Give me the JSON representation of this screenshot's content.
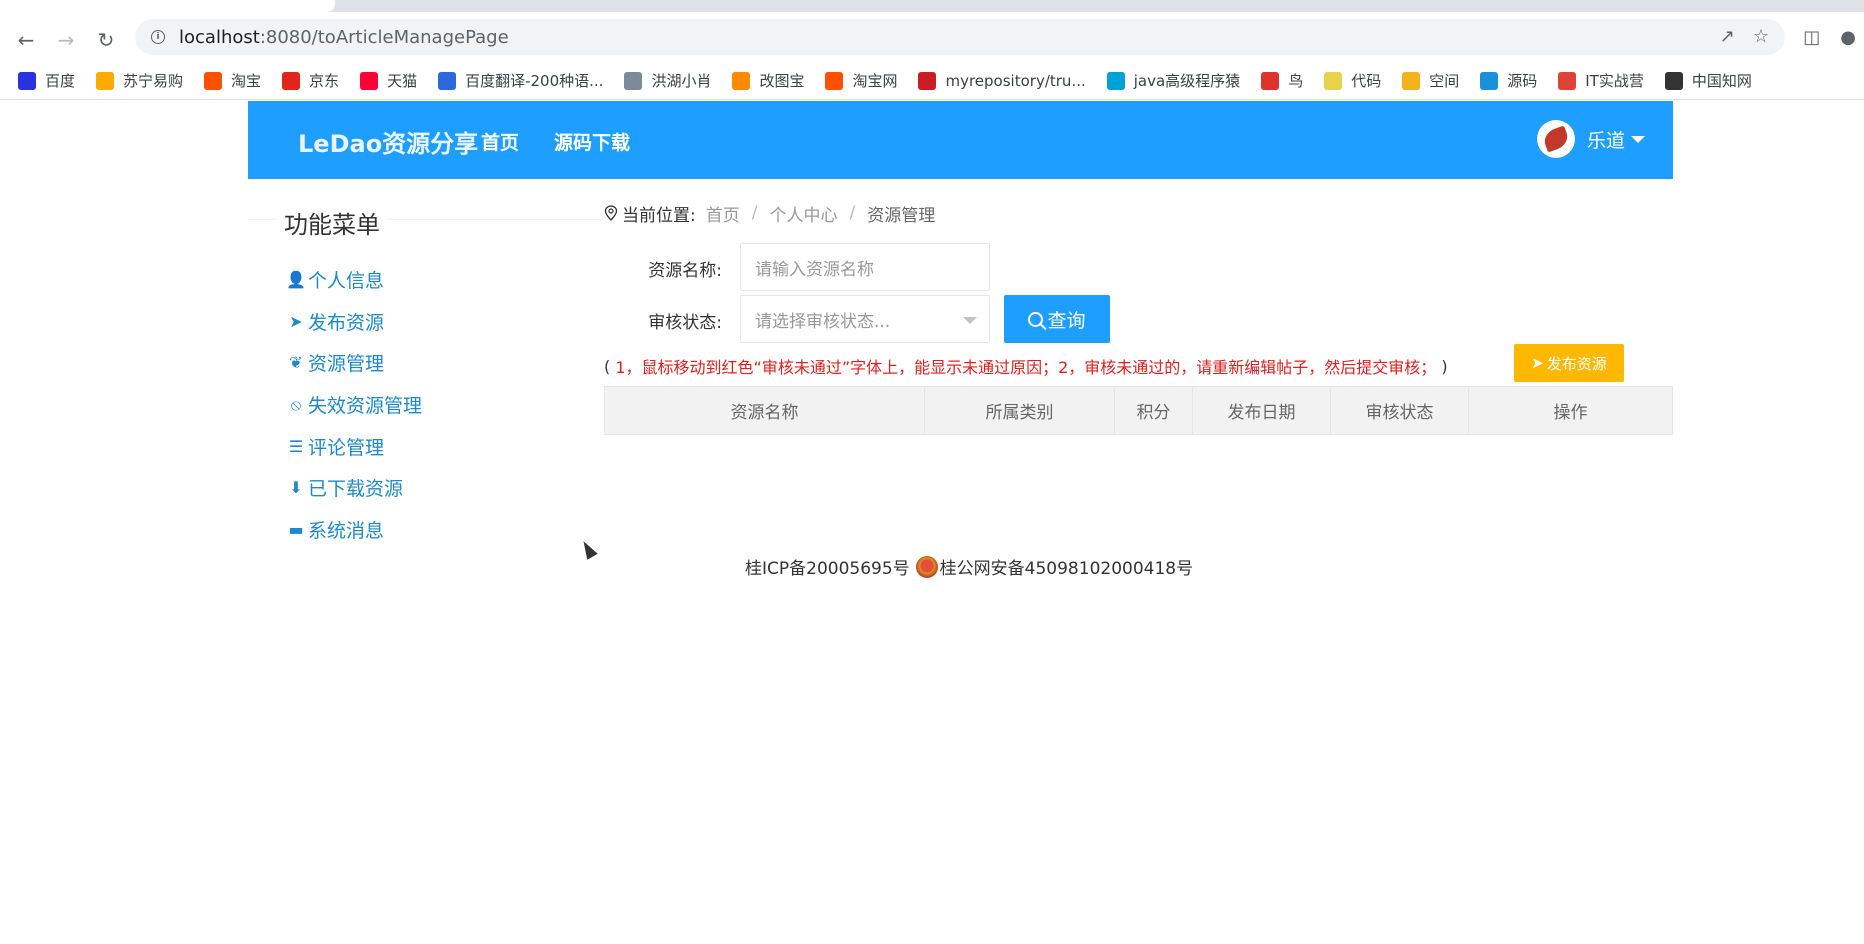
{
  "browser": {
    "url_host": "localhost",
    "url_rest": ":8080/toArticleManagePage",
    "bookmarks": [
      {
        "label": "百度",
        "icon": "baidu-paw-icon",
        "color": "#2932e1"
      },
      {
        "label": "苏宁易购",
        "icon": "suning-icon",
        "color": "#ffaa00"
      },
      {
        "label": "淘宝",
        "icon": "taobao-icon",
        "color": "#ff5000"
      },
      {
        "label": "京东",
        "icon": "jd-icon",
        "color": "#e1251b"
      },
      {
        "label": "天猫",
        "icon": "tmall-icon",
        "color": "#ff0036"
      },
      {
        "label": "百度翻译-200种语...",
        "icon": "baidu-translate-icon",
        "color": "#2b68d9"
      },
      {
        "label": "洪湖小肖",
        "icon": "bird-icon",
        "color": "#7a8a99"
      },
      {
        "label": "改图宝",
        "icon": "gaitubao-icon",
        "color": "#ff8a00"
      },
      {
        "label": "淘宝网",
        "icon": "taobao-icon",
        "color": "#ff5000"
      },
      {
        "label": "myrepository/tru...",
        "icon": "gitee-icon",
        "color": "#c71d23"
      },
      {
        "label": "java高级程序猿",
        "icon": "bilibili-icon",
        "color": "#00a1d6"
      },
      {
        "label": "鸟",
        "icon": "bird-red-icon",
        "color": "#e0322c"
      },
      {
        "label": "代码",
        "icon": "leaf-icon",
        "color": "#e8d24a"
      },
      {
        "label": "空间",
        "icon": "qzone-icon",
        "color": "#f3b11b"
      },
      {
        "label": "源码",
        "icon": "cloud-icon",
        "color": "#1a90d9"
      },
      {
        "label": "IT实战营",
        "icon": "chrome-icon",
        "color": "#db4437"
      },
      {
        "label": "中国知网",
        "icon": "cnki-icon",
        "color": "#333333"
      }
    ]
  },
  "nav": {
    "brand": "LeDao资源分享",
    "links": [
      "首页",
      "源码下载"
    ],
    "username": "乐道"
  },
  "sidebar": {
    "title": "功能菜单",
    "items": [
      {
        "label": "个人信息",
        "icon": "user-icon"
      },
      {
        "label": "发布资源",
        "icon": "paper-plane-icon"
      },
      {
        "label": "资源管理",
        "icon": "leaf-icon"
      },
      {
        "label": "失效资源管理",
        "icon": "ban-icon"
      },
      {
        "label": "评论管理",
        "icon": "comment-icon"
      },
      {
        "label": "已下载资源",
        "icon": "download-circle-icon"
      },
      {
        "label": "系统消息",
        "icon": "monitor-icon"
      }
    ]
  },
  "breadcrumb": {
    "label": "当前位置:",
    "items": [
      "首页",
      "个人中心",
      "资源管理"
    ]
  },
  "search": {
    "name_label": "资源名称:",
    "name_placeholder": "请输入资源名称",
    "status_label": "审核状态:",
    "status_placeholder": "请选择审核状态...",
    "query_label": "查询"
  },
  "notice": {
    "open": "(",
    "text": "1，鼠标移动到红色“审核未通过”字体上，能显示未通过原因；2，审核未通过的，请重新编辑帖子，然后提交审核；",
    "close": ")",
    "publish_label": "发布资源"
  },
  "table": {
    "columns": [
      "资源名称",
      "所属类别",
      "积分",
      "发布日期",
      "审核状态",
      "操作"
    ]
  },
  "footer": {
    "icp": "桂ICP备20005695号",
    "police": "桂公网安备45098102000418号"
  },
  "colors": {
    "primary": "#1e9fff",
    "warning": "#ffb800",
    "notice_red": "#e02020"
  }
}
